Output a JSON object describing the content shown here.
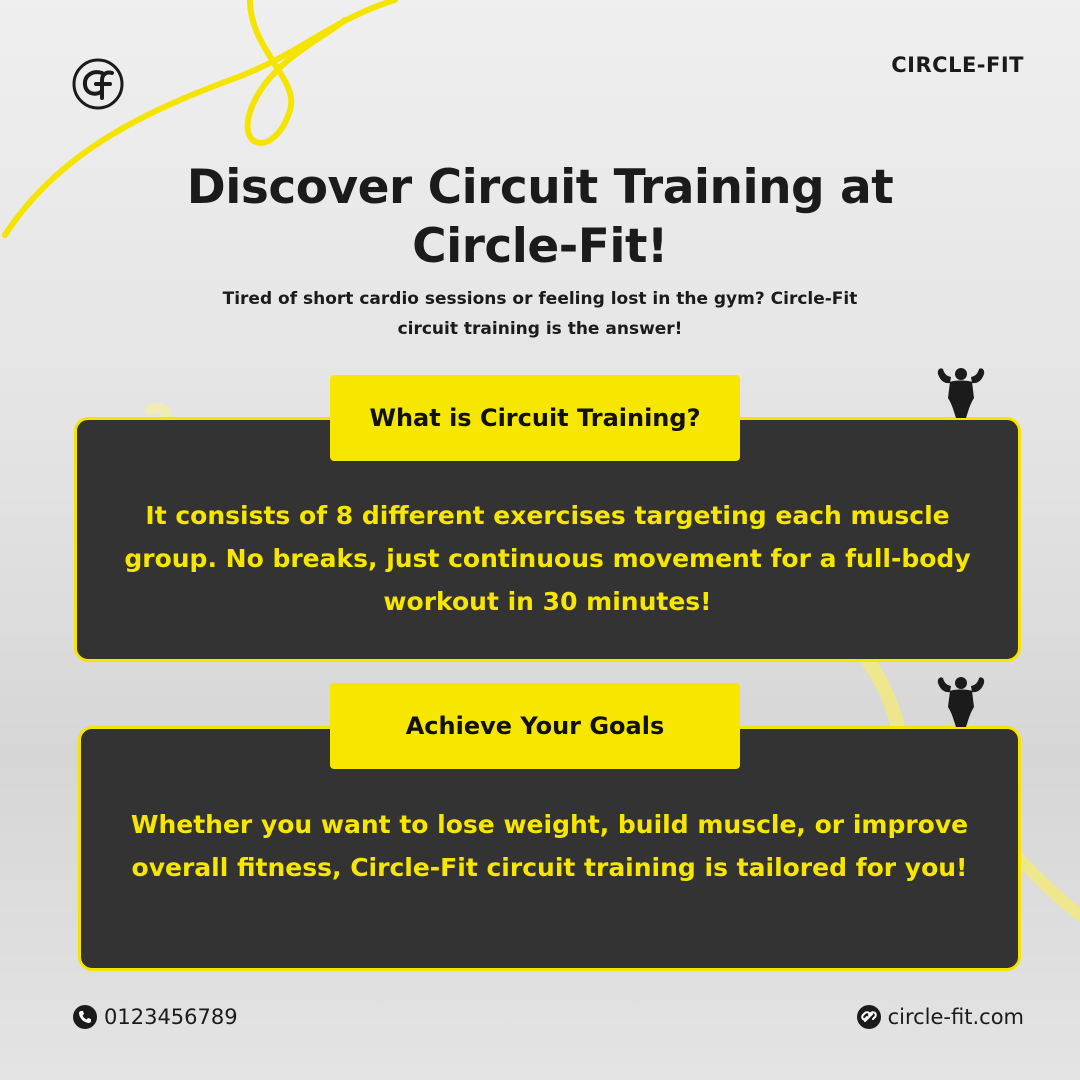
{
  "brand": {
    "name": "CIRCLE-FIT",
    "logo_icon": "circle-fit-logo-icon"
  },
  "hero": {
    "title": "Discover Circuit Training at Circle-Fit!",
    "intro": "Tired of short cardio sessions or feeling lost in the gym? Circle-Fit circuit training is the answer!"
  },
  "cards": [
    {
      "heading": "What is Circuit Training?",
      "body": "It consists of 8 different exercises targeting each muscle group. No breaks, just continuous movement for a full-body workout in 30 minutes!",
      "icon": "bodybuilder-flex-icon"
    },
    {
      "heading": "Achieve Your Goals",
      "body": "Whether you want to lose weight, build muscle, or improve overall fitness, Circle-Fit circuit training is tailored for you!",
      "icon": "bodybuilder-flex-icon"
    }
  ],
  "footer": {
    "phone": "0123456789",
    "website": "circle-fit.com",
    "phone_icon": "phone-icon",
    "link_icon": "link-icon"
  },
  "colors": {
    "accent_yellow": "#f7e600",
    "card_dark": "#333333",
    "text_dark": "#1b1b1b"
  }
}
